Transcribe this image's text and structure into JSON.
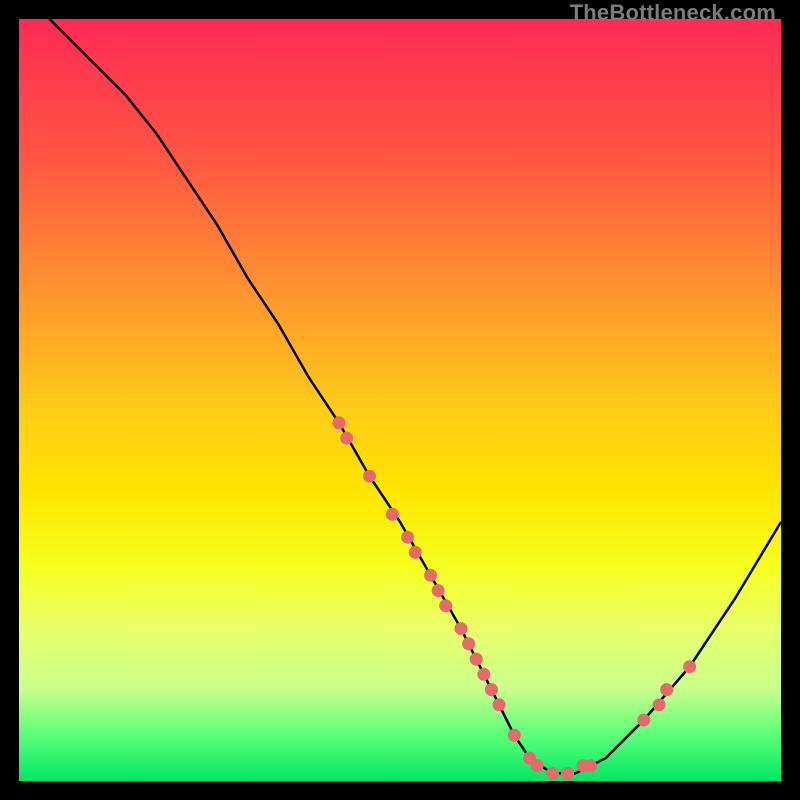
{
  "attribution": "TheBottleneck.com",
  "chart_data": {
    "type": "line",
    "title": "",
    "xlabel": "",
    "ylabel": "",
    "xlim": [
      0,
      100
    ],
    "ylim": [
      0,
      100
    ],
    "curve": {
      "x": [
        4,
        7,
        10,
        14,
        18,
        22,
        26,
        30,
        34,
        38,
        42,
        46,
        50,
        54,
        58,
        61,
        63,
        65,
        67,
        70,
        73,
        77,
        82,
        88,
        94,
        100
      ],
      "y": [
        100,
        97,
        94,
        90,
        85,
        79,
        73,
        66,
        60,
        53,
        47,
        40,
        34,
        27,
        20,
        14,
        10,
        6,
        3,
        1,
        1,
        3,
        8,
        15,
        24,
        34
      ]
    },
    "markers": {
      "note": "salmon dots along the curve near the valley and on the rising branch",
      "x": [
        42,
        43,
        46,
        49,
        51,
        52,
        54,
        55,
        56,
        58,
        59,
        60,
        61,
        62,
        63,
        65,
        67,
        68,
        70,
        72,
        74,
        75,
        82,
        84,
        85,
        88
      ],
      "y": [
        47,
        45,
        40,
        35,
        32,
        30,
        27,
        25,
        23,
        20,
        18,
        16,
        14,
        12,
        10,
        6,
        3,
        2,
        1,
        1,
        2,
        2,
        8,
        10,
        12,
        15
      ],
      "color": "#e66a6a"
    },
    "colors": {
      "curve": "#000000",
      "marker": "#e66a6a",
      "background_top": "#ff2a55",
      "background_mid": "#ffe600",
      "background_bottom": "#00e865",
      "frame": "#000000"
    }
  }
}
